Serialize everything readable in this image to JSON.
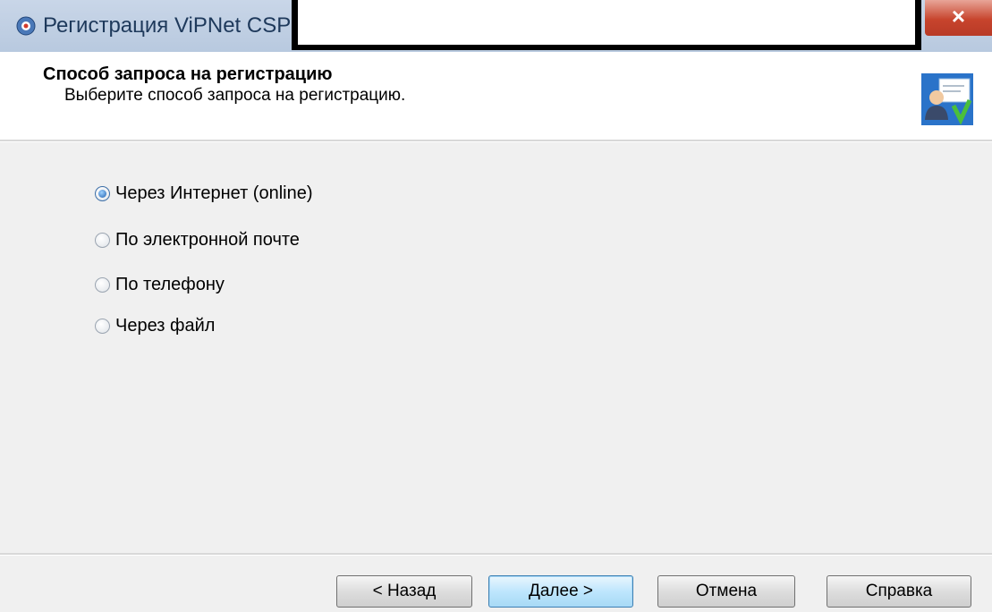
{
  "window": {
    "title": "Регистрация ViPNet CSP",
    "close_label": "×"
  },
  "header": {
    "title": "Способ запроса на регистрацию",
    "subtitle": "Выберите способ запроса на регистрацию."
  },
  "options": [
    {
      "label": "Через Интернет (online)",
      "checked": true
    },
    {
      "label": "По электронной почте",
      "checked": false
    },
    {
      "label": "По телефону",
      "checked": false
    },
    {
      "label": "Через файл",
      "checked": false
    }
  ],
  "buttons": {
    "back": "< Назад",
    "next": "Далее >",
    "cancel": "Отмена",
    "help": "Справка"
  },
  "icons": {
    "title": "vipnet-app-icon",
    "header": "user-registration-icon"
  },
  "colors": {
    "titlebar": "#c9d6e8",
    "close": "#c7442d",
    "default_button": "#bee6fd"
  }
}
